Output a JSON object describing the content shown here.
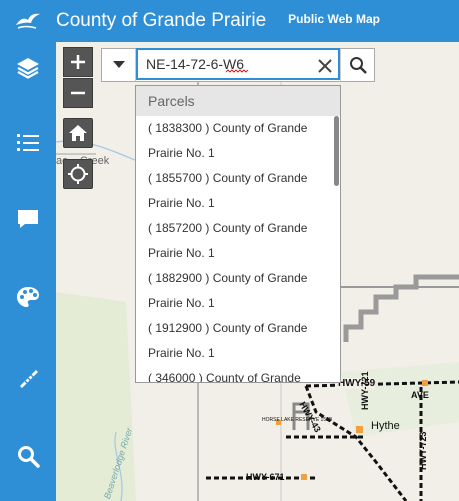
{
  "header": {
    "title": "County of Grande Prairie",
    "subtitle": "Public Web Map"
  },
  "sidebar": {
    "items": [
      {
        "name": "layers-icon"
      },
      {
        "name": "legend-list-icon"
      },
      {
        "name": "comment-icon"
      },
      {
        "name": "basemap-palette-icon"
      },
      {
        "name": "measure-ruler-icon"
      },
      {
        "name": "search-icon"
      }
    ]
  },
  "search": {
    "value": "NE-14-72-6-W6"
  },
  "suggestions": {
    "header": "Parcels",
    "items": [
      {
        "line1": "( 1838300 ) County of Grande",
        "line2": "Prairie No. 1"
      },
      {
        "line1": "( 1855700 ) County of Grande",
        "line2": "Prairie No. 1"
      },
      {
        "line1": "( 1857200 ) County of Grande",
        "line2": "Prairie No. 1"
      },
      {
        "line1": "( 1882900 ) County of Grande",
        "line2": "Prairie No. 1"
      },
      {
        "line1": "( 1912900 ) County of Grande",
        "line2": "Prairie No. 1"
      },
      {
        "line1": "( 346000 ) County of Grande",
        "line2": ""
      }
    ]
  },
  "map_labels": {
    "creek": "Creek",
    "creek_prefix": "ac",
    "hwy59": "HWY-59",
    "hwy721": "HWY-721",
    "hwy43": "HWY-43",
    "hwy671": "HWY-671",
    "hwy723": "HWY-723",
    "hythe": "Hythe",
    "ave": "AVE",
    "reserve": "HORSE LAKE RESERVE 152B",
    "river": "Beaverlodge River"
  },
  "colors": {
    "brand": "#2e8fd6",
    "map_bg": "#f1efe8",
    "boundary": "#9a9a9a",
    "highway": "#111111"
  }
}
